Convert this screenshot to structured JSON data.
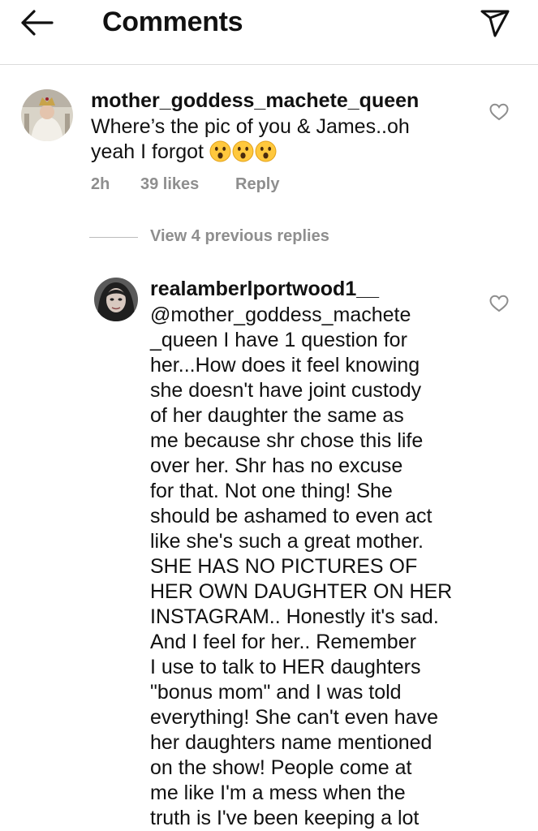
{
  "header": {
    "title": "Comments",
    "back_icon": "arrow-left-icon",
    "share_icon": "paper-plane-icon"
  },
  "comment": {
    "username": "mother_goddess_machete_queen",
    "lines": [
      "Where’s the pic of you & James..oh",
      "yeah I forgot"
    ],
    "emoji": [
      "😮",
      "😮",
      "😮"
    ],
    "time": "2h",
    "likes": "39 likes",
    "reply": "Reply"
  },
  "view_replies": "View 4 previous replies",
  "reply": {
    "username": "realamberlportwood1__",
    "lines": [
      "@mother_goddess_machete",
      "_queen I have 1 question for",
      "her...How does it feel knowing",
      "she doesn't have joint custody",
      "of her daughter the same as",
      "me because shr chose this life",
      "over her. Shr has no excuse",
      "for that. Not one thing! She",
      "should be ashamed to even act",
      "like she's such a great mother.",
      "SHE HAS NO PICTURES OF",
      "HER OWN DAUGHTER ON HER",
      "INSTAGRAM.. Honestly it's sad.",
      "And I feel for her.. Remember",
      "I use to talk to HER daughters",
      "\"bonus mom\" and I was told",
      "everything! She can't even have",
      "her daughters name mentioned",
      "on the show!  People come at",
      "me like I'm a mess when the",
      "truth is I've been keeping a lot"
    ]
  }
}
